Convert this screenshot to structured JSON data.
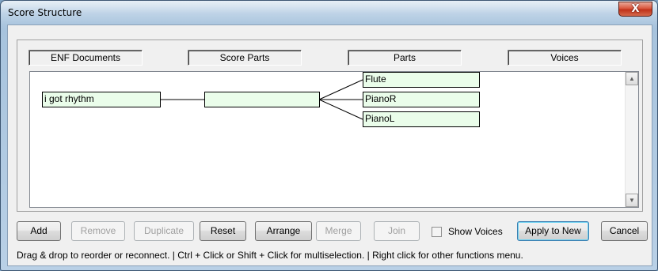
{
  "window": {
    "title": "Score Structure",
    "close_glyph": "X"
  },
  "columns": [
    "ENF Documents",
    "Score Parts",
    "Parts",
    "Voices"
  ],
  "tree": {
    "document": "i got rhythm",
    "score_part": "",
    "parts": [
      "Flute",
      "PianoR",
      "PianoL"
    ]
  },
  "buttons": {
    "add": "Add",
    "remove": "Remove",
    "duplicate": "Duplicate",
    "reset": "Reset",
    "arrange": "Arrange",
    "merge": "Merge",
    "join": "Join",
    "apply_to_new": "Apply to New",
    "cancel": "Cancel"
  },
  "show_voices": {
    "label": "Show Voices",
    "checked": false
  },
  "hint": "Drag & drop to reorder or reconnect. | Ctrl + Click or Shift + Click for multiselection. | Right click for other functions menu.",
  "icons": {
    "close": "close-icon",
    "scroll_up": "scroll-up-icon",
    "scroll_down": "scroll-down-icon"
  }
}
